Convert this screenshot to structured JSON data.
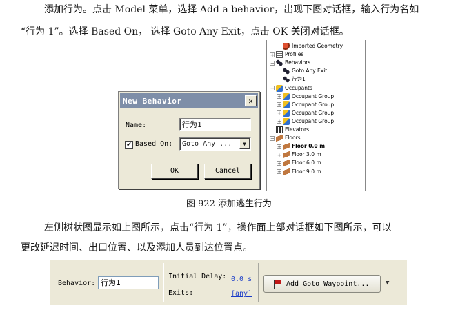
{
  "paragraphs": {
    "p1": "添加行为。点击 Model 菜单，选择 Add a behavior，出现下图对话框，输入行为名如",
    "p2": "“行为 1”。选择 Based On，  选择 Goto Any Exit，点击 OK 关闭对话框。",
    "p3": "左侧树状图显示如上图所示，点击“行为 1”，操作面上部对话框如下图所示，可以",
    "p4": "更改延迟时间、出口位置、以及添加人员到达位置点。"
  },
  "caption": "图 922  添加逃生行为",
  "dialog": {
    "title": "New Behavior",
    "close_icon": "close-icon",
    "name_label": "Name:",
    "name_value": "行为1",
    "based_on_checked": true,
    "check_mark": "✔",
    "based_on_label": "Based On:",
    "based_on_value": "Goto Any ...",
    "dropdown_icon": "chevron-down-icon",
    "ok_label": "OK",
    "cancel_label": "Cancel"
  },
  "tree": {
    "items": [
      {
        "label": "Imported Geometry",
        "icon": "geometry-icon",
        "expander": "",
        "bold": false
      },
      {
        "label": "Profiles",
        "icon": "profiles-icon",
        "expander": "+",
        "bold": false
      },
      {
        "label": "Behaviors",
        "icon": "footprints-icon",
        "expander": "−",
        "bold": false
      },
      {
        "label": "Goto Any Exit",
        "icon": "footprints-icon",
        "expander": "",
        "bold": false
      },
      {
        "label": "行为1",
        "icon": "footprints-icon",
        "expander": "",
        "bold": false
      },
      {
        "label": "Occupants",
        "icon": "occupants-icon",
        "expander": "−",
        "bold": false
      },
      {
        "label": "Occupant Group",
        "icon": "occupant-group-icon",
        "expander": "+",
        "bold": false
      },
      {
        "label": "Occupant Group",
        "icon": "occupant-group-icon",
        "expander": "+",
        "bold": false
      },
      {
        "label": "Occupant Group",
        "icon": "occupant-group-icon",
        "expander": "+",
        "bold": false
      },
      {
        "label": "Occupant Group",
        "icon": "occupant-group-icon",
        "expander": "+",
        "bold": false
      },
      {
        "label": "Elevators",
        "icon": "elevator-icon",
        "expander": "",
        "bold": false
      },
      {
        "label": "Floors",
        "icon": "floor-icon",
        "expander": "−",
        "bold": false
      },
      {
        "label": "Floor 0.0 m",
        "icon": "floor-icon",
        "expander": "+",
        "bold": true
      },
      {
        "label": "Floor 3.0 m",
        "icon": "floor-icon",
        "expander": "+",
        "bold": false
      },
      {
        "label": "Floor 6.0 m",
        "icon": "floor-icon",
        "expander": "+",
        "bold": false
      },
      {
        "label": "Floor 9.0 m",
        "icon": "floor-icon",
        "expander": "+",
        "bold": false
      }
    ]
  },
  "toolbar": {
    "behavior_label": "Behavior:",
    "behavior_value": "行为1",
    "initial_delay_label": "Initial Delay:",
    "initial_delay_value": "0.0 s",
    "exits_label": "Exits:",
    "exits_value": "[any]",
    "add_waypoint_label": "Add Goto Waypoint...",
    "flag_icon": "red-flag-icon",
    "dropdown_icon": "chevron-down-icon",
    "dropdown_glyph": "▼"
  }
}
